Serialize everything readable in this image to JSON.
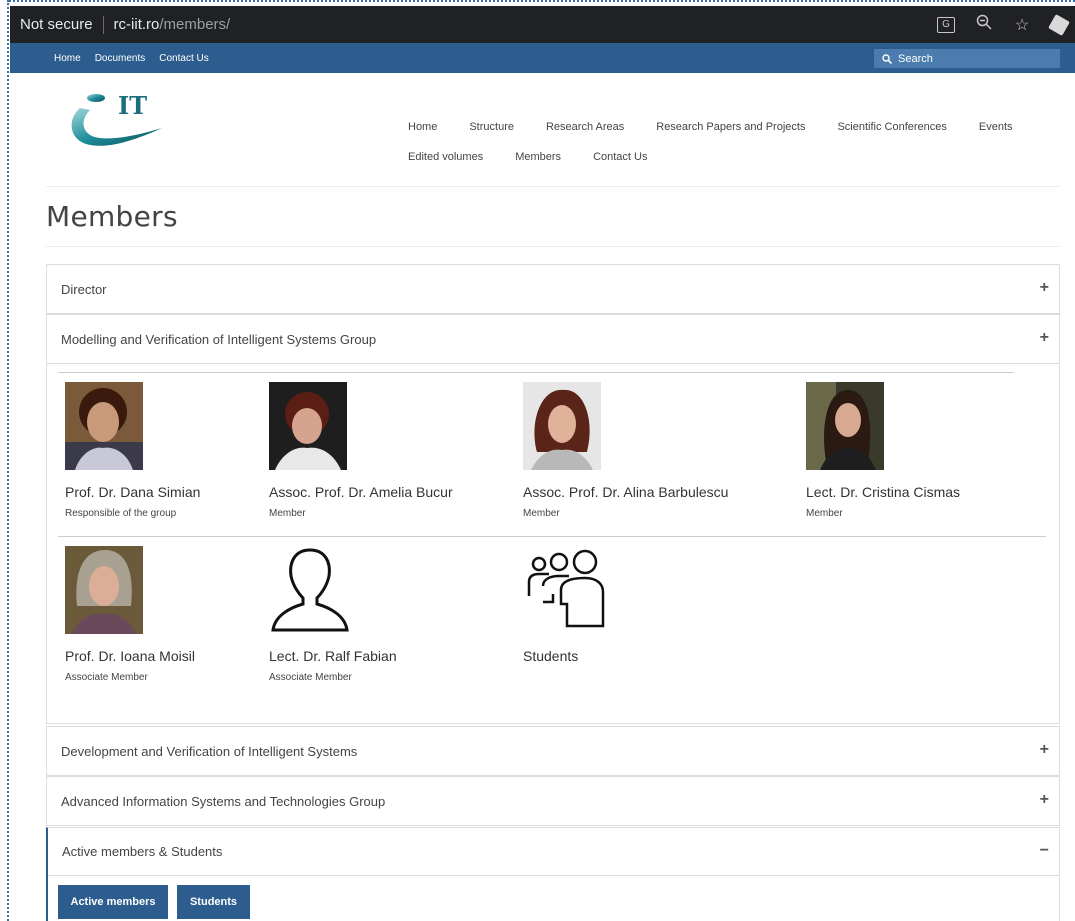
{
  "browser": {
    "security": "Not secure",
    "host": "rc-iit.ro",
    "path": "/members/",
    "icons": [
      "translate-icon",
      "zoom-icon",
      "star-icon",
      "extension-icon"
    ]
  },
  "util_bar": {
    "links": [
      "Home",
      "Documents",
      "Contact Us"
    ],
    "search_placeholder": "Search"
  },
  "logo": {
    "text": "IT"
  },
  "nav": {
    "row1": [
      "Home",
      "Structure",
      "Research Areas",
      "Research Papers and Projects",
      "Scientific Conferences",
      "Events"
    ],
    "row2": [
      "Edited volumes",
      "Members",
      "Contact Us"
    ]
  },
  "page_title": "Members",
  "sections": {
    "director": {
      "label": "Director",
      "toggle": "+"
    },
    "modelling": {
      "label": "Modelling and Verification of Intelligent Systems Group",
      "toggle": "+"
    },
    "development": {
      "label": "Development and Verification of Intelligent Systems",
      "toggle": "+"
    },
    "advanced": {
      "label": "Advanced Information Systems and Technologies Group",
      "toggle": "+"
    },
    "active": {
      "label": "Active members & Students",
      "toggle": "−"
    }
  },
  "members": [
    {
      "name": "Prof. Dr. Dana Simian",
      "role": "Responsible of the group"
    },
    {
      "name": "Assoc. Prof. Dr. Amelia Bucur",
      "role": "Member"
    },
    {
      "name": "Assoc. Prof. Dr. Alina Barbulescu",
      "role": "Member"
    },
    {
      "name": "Lect. Dr. Cristina Cismas",
      "role": "Member"
    },
    {
      "name": "Prof. Dr. Ioana Moisil",
      "role": "Associate Member"
    },
    {
      "name": "Lect. Dr. Ralf Fabian",
      "role": "Associate Member"
    },
    {
      "name": "Students",
      "role": ""
    }
  ],
  "buttons": {
    "active_members": "Active members",
    "students": "Students"
  },
  "colors": {
    "brand_blue": "#2c5d8e",
    "browser_dark": "#202124"
  }
}
